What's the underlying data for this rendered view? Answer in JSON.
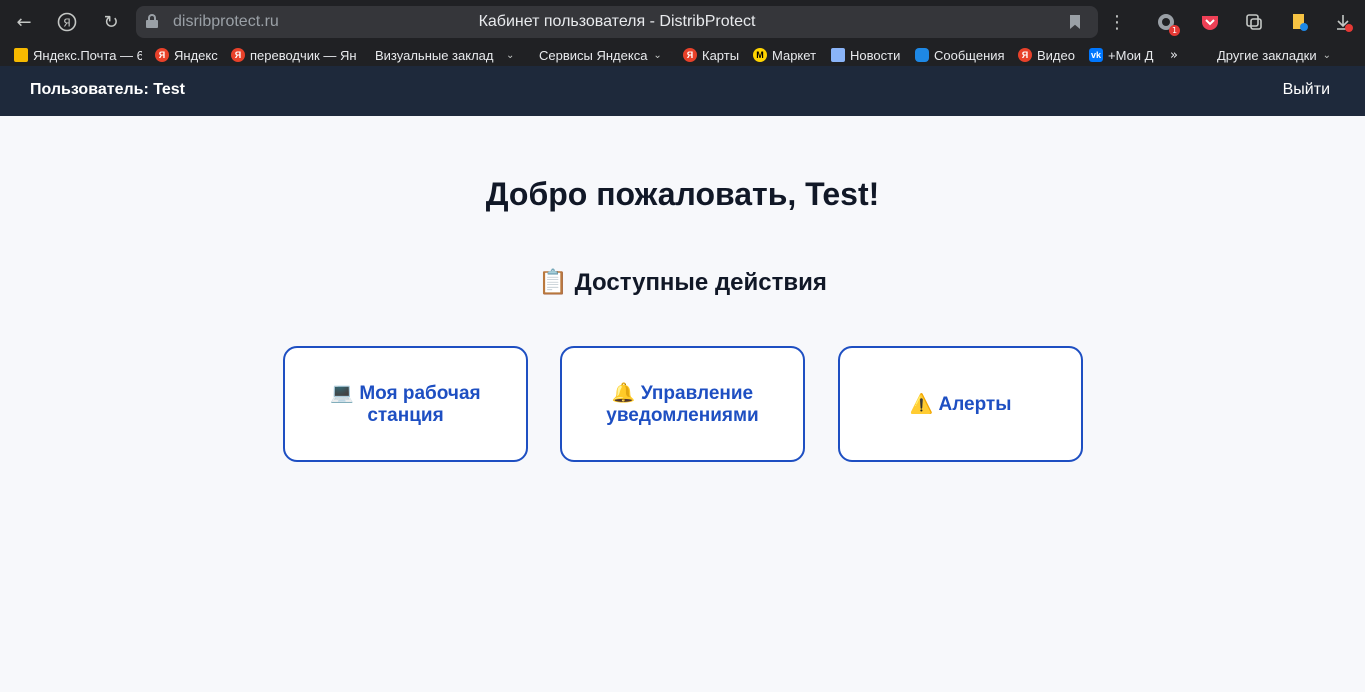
{
  "browser": {
    "url": "disribprotect.ru",
    "tab_title": "Кабинет пользователя - DistribProtect",
    "extension_badge": "1",
    "bookmarks": [
      {
        "label": "Яндекс.Почта — 6",
        "icon": "mail-icon"
      },
      {
        "label": "Яндекс",
        "icon": "yandex-icon"
      },
      {
        "label": "переводчик — Ян",
        "icon": "yandex-icon"
      },
      {
        "label": "Визуальные заклад",
        "icon": "folder-icon"
      },
      {
        "label": "Сервисы Яндекса",
        "icon": "folder-icon"
      },
      {
        "label": "Карты",
        "icon": "yandex-icon"
      },
      {
        "label": "Маркет",
        "icon": "market-icon"
      },
      {
        "label": "Новости",
        "icon": "news-icon"
      },
      {
        "label": "Сообщения",
        "icon": "messages-icon"
      },
      {
        "label": "Видео",
        "icon": "yandex-icon"
      },
      {
        "label": "+Мои Д",
        "icon": "vk-icon"
      },
      {
        "label": "Другие закладки",
        "icon": "folder-icon"
      }
    ]
  },
  "header": {
    "user_label": "Пользователь: Test",
    "logout_label": "Выйти"
  },
  "main": {
    "welcome": "Добро пожаловать, Test!",
    "actions_emoji": "📋",
    "actions_title": "Доступные действия",
    "cards": [
      {
        "emoji": "💻",
        "label": "Моя рабочая станция"
      },
      {
        "emoji": "🔔",
        "label": "Управление уведомлениями"
      },
      {
        "emoji": "⚠️",
        "label": "Алерты"
      }
    ]
  },
  "colors": {
    "header_bg": "#1e293b",
    "card_accent": "#1e4fc2",
    "page_bg": "#f7f8fb"
  }
}
